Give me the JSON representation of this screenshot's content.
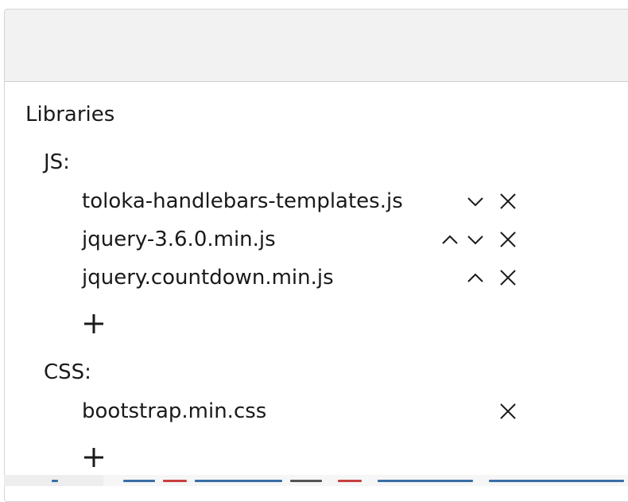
{
  "libraries": {
    "title": "Libraries",
    "js": {
      "label": "JS:",
      "items": [
        {
          "name": "toloka-handlebars-templates.js",
          "can_move_up": false,
          "can_move_down": true
        },
        {
          "name": "jquery-3.6.0.min.js",
          "can_move_up": true,
          "can_move_down": true
        },
        {
          "name": "jquery.countdown.min.js",
          "can_move_up": true,
          "can_move_down": false
        }
      ]
    },
    "css": {
      "label": "CSS:",
      "items": [
        {
          "name": "bootstrap.min.css",
          "can_move_up": false,
          "can_move_down": false
        }
      ]
    }
  },
  "icons": {
    "move_up": "chevron-up-icon",
    "move_down": "chevron-down-icon",
    "remove": "close-icon",
    "add": "plus-icon"
  },
  "colors": {
    "header_bg": "#f2f2f2",
    "border": "#d4d4d4",
    "text": "#1a1a1a"
  }
}
